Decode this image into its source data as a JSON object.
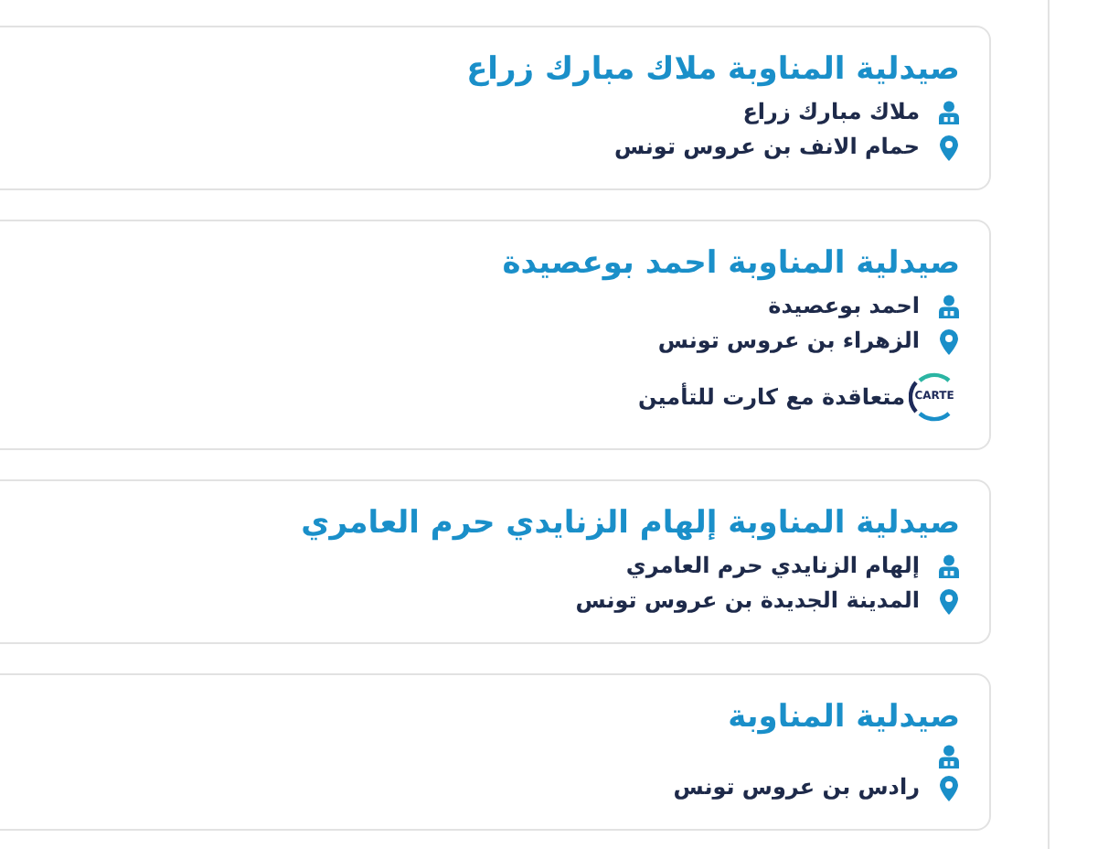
{
  "pharmacies": [
    {
      "title": "صيدلية المناوبة ملاك مبارك زراع",
      "details": [
        {
          "kind": "owner",
          "text": "ملاك مبارك زراع"
        },
        {
          "kind": "address",
          "text": "حمام الانف بن عروس تونس"
        }
      ]
    },
    {
      "title": "صيدلية المناوبة احمد بوعصيدة",
      "details": [
        {
          "kind": "owner",
          "text": "احمد بوعصيدة"
        },
        {
          "kind": "address",
          "text": "الزهراء بن عروس تونس"
        },
        {
          "kind": "insurance",
          "logo_text": "CARTE",
          "text": "متعاقدة مع كارت للتأمين"
        }
      ]
    },
    {
      "title": "صيدلية المناوبة إلهام الزنايدي حرم العامري",
      "details": [
        {
          "kind": "owner",
          "text": "إلهام الزنايدي حرم العامري"
        },
        {
          "kind": "address",
          "text": "المدينة الجديدة بن عروس تونس"
        }
      ]
    },
    {
      "title": "صيدلية المناوبة",
      "details": [
        {
          "kind": "owner"
        },
        {
          "kind": "address",
          "text": "رادس بن عروس تونس"
        }
      ]
    }
  ]
}
